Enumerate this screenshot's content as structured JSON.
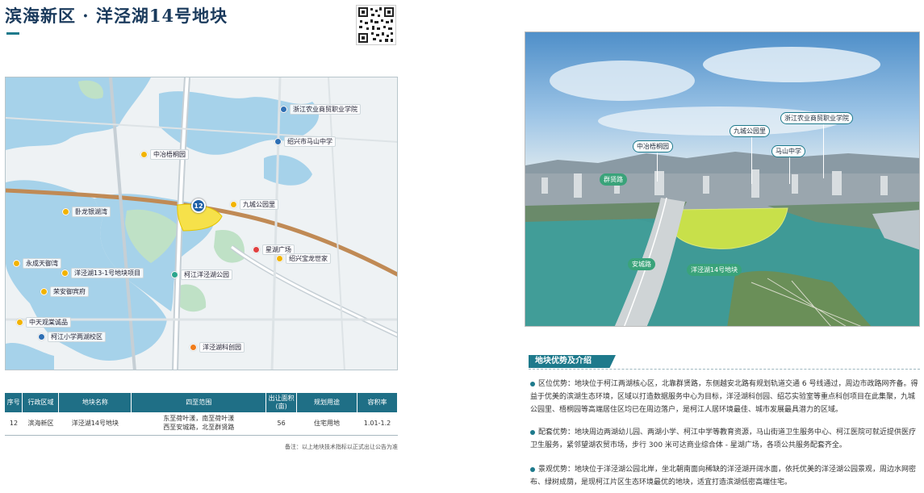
{
  "header": {
    "title": "滨海新区 · 洋泾湖14号地块"
  },
  "map": {
    "plot_number": "12",
    "pois": [
      {
        "name": "浙江农业商贸职业学院",
        "kind": "blue"
      },
      {
        "name": "绍兴市马山中学",
        "kind": "blue"
      },
      {
        "name": "中冶梧桐园",
        "kind": "yellow"
      },
      {
        "name": "九城公园里",
        "kind": "yellow"
      },
      {
        "name": "卧龙银湖湾",
        "kind": "yellow"
      },
      {
        "name": "星湖广场",
        "kind": "red"
      },
      {
        "name": "绍兴宝龙世家",
        "kind": "yellow"
      },
      {
        "name": "永成天御湾",
        "kind": "yellow"
      },
      {
        "name": "洋泾湖13-1号地块项目",
        "kind": "yellow"
      },
      {
        "name": "柯江洋泾湖公园",
        "kind": "green"
      },
      {
        "name": "荣安御宾府",
        "kind": "yellow"
      },
      {
        "name": "中天观棠诚品",
        "kind": "yellow"
      },
      {
        "name": "柯江小学两湖校区",
        "kind": "blue"
      },
      {
        "name": "洋泾湖科创园",
        "kind": "orange"
      }
    ]
  },
  "table": {
    "headers": [
      "序号",
      "行政区域",
      "地块名称",
      "四至范围",
      "出让面积(亩)",
      "规划用途",
      "容积率"
    ],
    "row": {
      "no": "12",
      "district": "滨海新区",
      "name": "洋泾湖14号地块",
      "bounds_line1": "东至荷叶漾，南至荷叶漾",
      "bounds_line2": "西至安城路，北至群贤路",
      "area": "56",
      "use": "住宅用地",
      "far": "1.01-1.2"
    },
    "note": "备注：以上地块技术指标以正式出让公告为准"
  },
  "photo": {
    "labels": {
      "school": "浙江农业商贸职业学院",
      "jiucheng": "九城公园里",
      "zhongye": "中冶梧桐园",
      "mashan": "马山中学",
      "qunxian": "群贤路",
      "ancheng": "安城路",
      "plot": "洋泾湖14号地块"
    }
  },
  "advantages": {
    "heading": "地块优势及介绍",
    "location": "区位优势：地块位于柯江两湖核心区，北靠群贤路，东侧越安北路有规划轨道交通 6 号线通过，周边市政路网齐备。得益于优美的滨湖生态环境，区域以打造数据服务中心为目标，洋泾湖科创园、绍芯实验室等重点科创项目在此集聚，九城公园里、梧桐园等高端居住区均已在周边落户，是柯江人居环境最佳、城市发展最具潜力的区域。",
    "facilities": "配套优势：地块周边两湖幼儿园、两湖小学、柯江中学等教育资源，马山街道卫生服务中心、柯江医院可就近提供医疗卫生服务，紧邻望湖农贸市场，步行 300 米可达商业综合体 - 星湖广场，各项公共服务配套齐全。",
    "landscape": "景观优势：地块位于洋泾湖公园北岸，坐北朝南面向稀缺的洋泾湖开阔水面，依托优美的洋泾湖公园景观，周边水网密布、绿树成荫，是现柯江片区生态环境最优的地块，适宜打造滨湖低密高端住宅。"
  }
}
